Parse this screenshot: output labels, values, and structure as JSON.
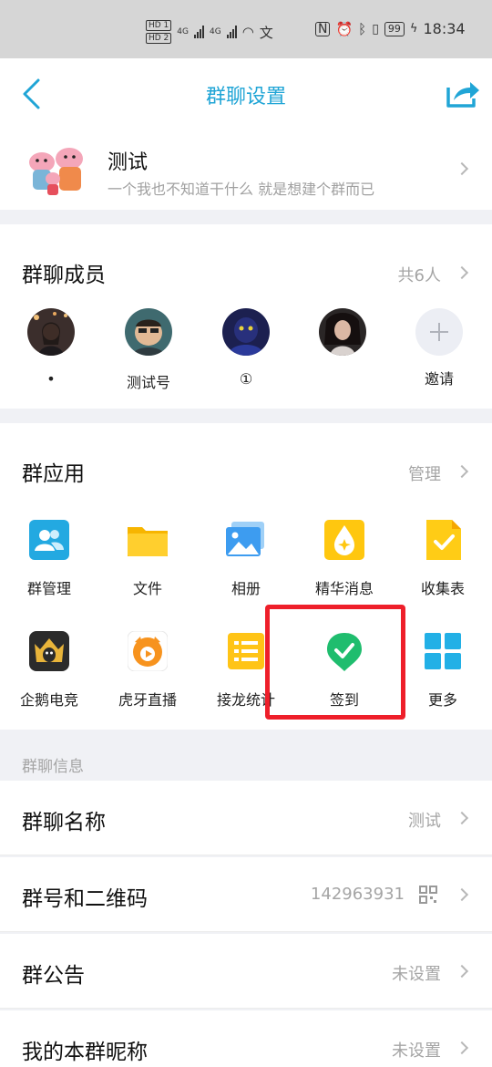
{
  "status_bar": {
    "hd1": "HD 1",
    "hd2": "HD 2",
    "net1": "4G",
    "net2": "4G",
    "wifi_extra": "文",
    "battery": "99",
    "time": "18:34"
  },
  "nav": {
    "title": "群聊设置"
  },
  "group": {
    "name": "测试",
    "description": "一个我也不知道干什么 就是想建个群而已"
  },
  "members": {
    "title": "群聊成员",
    "count": "共6人",
    "list": [
      {
        "name": "•"
      },
      {
        "name": "测试号"
      },
      {
        "name": "①"
      },
      {
        "name": ""
      },
      {
        "name": "邀请"
      }
    ]
  },
  "apps": {
    "title": "群应用",
    "manage": "管理",
    "items": [
      {
        "label": "群管理",
        "icon": "group-manage-icon"
      },
      {
        "label": "文件",
        "icon": "folder-icon"
      },
      {
        "label": "相册",
        "icon": "album-icon"
      },
      {
        "label": "精华消息",
        "icon": "essence-icon"
      },
      {
        "label": "收集表",
        "icon": "collect-form-icon"
      },
      {
        "label": "企鹅电竞",
        "icon": "esports-icon"
      },
      {
        "label": "虎牙直播",
        "icon": "huya-icon"
      },
      {
        "label": "接龙统计",
        "icon": "relay-icon"
      },
      {
        "label": "签到",
        "icon": "checkin-icon"
      },
      {
        "label": "更多",
        "icon": "more-icon"
      }
    ]
  },
  "info": {
    "section_label": "群聊信息",
    "rows": [
      {
        "title": "群聊名称",
        "value": "测试"
      },
      {
        "title": "群号和二维码",
        "value": "142963931"
      },
      {
        "title": "群公告",
        "value": "未设置"
      },
      {
        "title": "我的本群昵称",
        "value": "未设置"
      }
    ]
  },
  "colors": {
    "accent": "#20a5d6",
    "highlight": "#ee1f2a",
    "checkin": "#1fbd6e"
  }
}
